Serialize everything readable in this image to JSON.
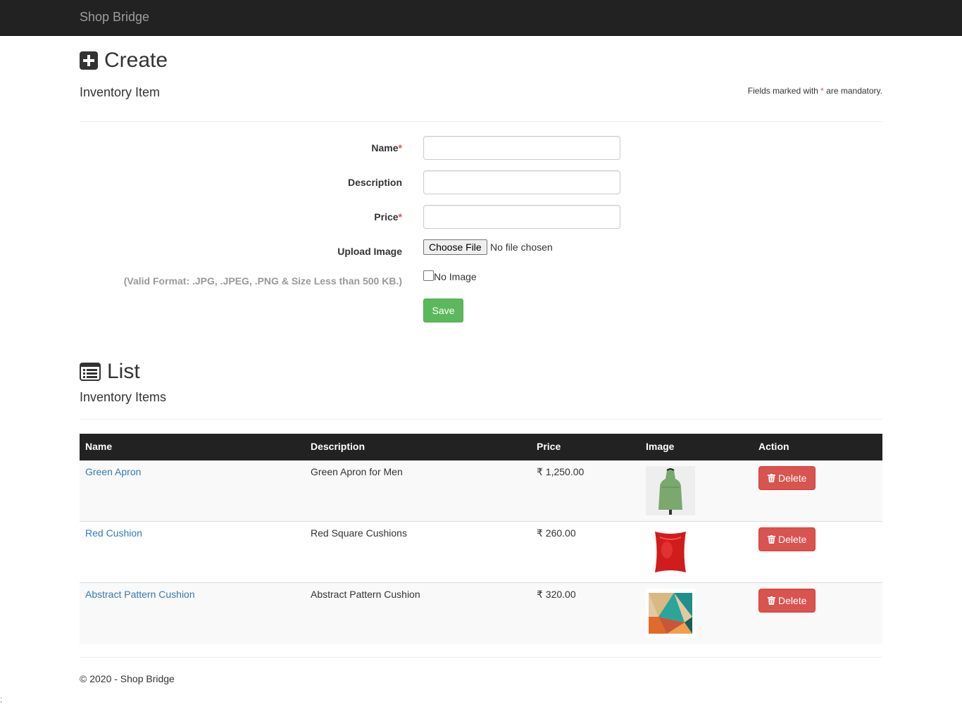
{
  "navbar": {
    "brand": "Shop Bridge"
  },
  "create": {
    "title": "Create",
    "subtitle": "Inventory Item",
    "mandatory_note_prefix": "Fields marked with ",
    "mandatory_note_star": "*",
    "mandatory_note_suffix": " are mandatory."
  },
  "form": {
    "name_label": "Name",
    "description_label": "Description",
    "price_label": "Price",
    "required_star": "*",
    "upload_label": "Upload Image",
    "upload_help": "(Valid Format: .JPG, .JPEG, .PNG & Size Less than 500 KB.)",
    "choose_file": "Choose File",
    "file_status": "No file chosen",
    "no_image_label": "No Image",
    "save_label": "Save"
  },
  "list": {
    "title": "List",
    "subtitle": "Inventory Items",
    "columns": [
      "Name",
      "Description",
      "Price",
      "Image",
      "Action"
    ],
    "rows": [
      {
        "name": "Green Apron",
        "description": "Green Apron for Men",
        "price": "₹ 1,250.00",
        "image": "green-apron-thumbnail",
        "action": "Delete"
      },
      {
        "name": "Red Cushion",
        "description": "Red Square Cushions",
        "price": "₹ 260.00",
        "image": "red-cushion-thumbnail",
        "action": "Delete"
      },
      {
        "name": "Abstract Pattern Cushion",
        "description": "Abstract Pattern Cushion",
        "price": "₹ 320.00",
        "image": "abstract-cushion-thumbnail",
        "action": "Delete"
      }
    ]
  },
  "footer": {
    "text": "© 2020 - Shop Bridge"
  },
  "stray_text": ";",
  "colors": {
    "navbar": "#222222",
    "link": "#337ab7",
    "save": "#5cb85c",
    "delete": "#d9534f",
    "required": "#d9534f"
  }
}
